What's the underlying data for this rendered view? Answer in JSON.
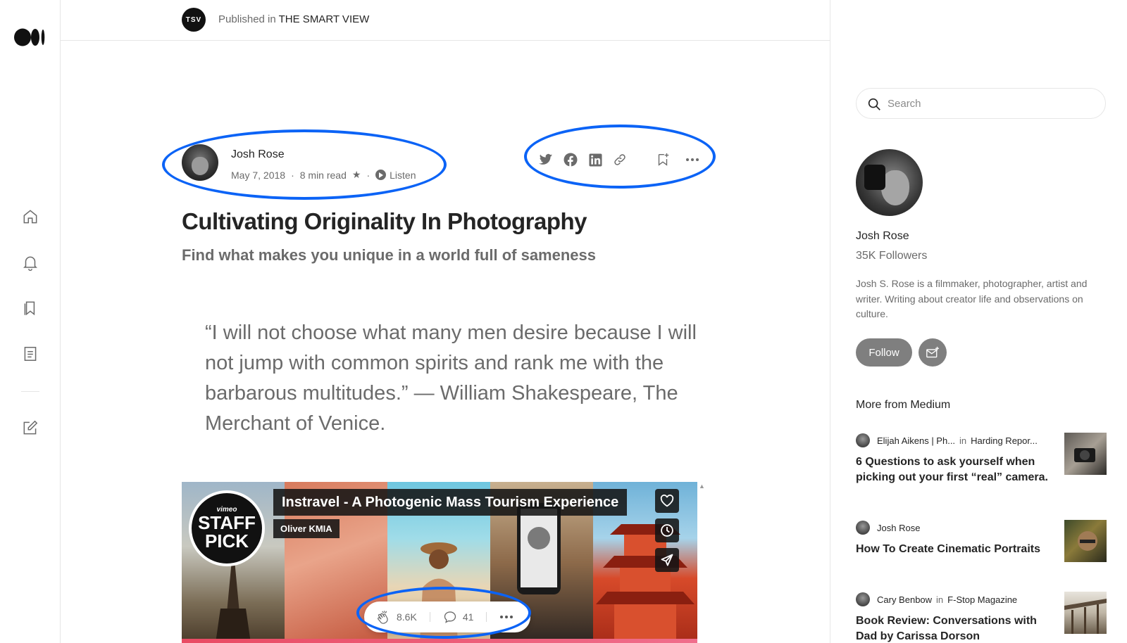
{
  "publication": {
    "logo_text": "TSV",
    "prefix": "Published in",
    "name": "THE SMART VIEW"
  },
  "article": {
    "author": "Josh Rose",
    "date": "May 7, 2018",
    "read_time": "8 min read",
    "listen_label": "Listen",
    "title": "Cultivating Originality In Photography",
    "subtitle": "Find what makes you unique in a world full of sameness",
    "quote": "“I will not choose what many men desire because I will not jump with common spirits and rank me with the barbarous multitudes.” — William Shakespeare, The Merchant of Venice."
  },
  "share_icons": [
    "twitter-icon",
    "facebook-icon",
    "linkedin-icon",
    "link-icon",
    "bookmark-add-icon",
    "more-icon"
  ],
  "embed": {
    "badge_top": "vimeo",
    "badge_line1": "STAFF",
    "badge_line2": "PICK",
    "video_title": "Instravel - A Photogenic Mass Tourism Experience",
    "video_author": "Oliver KMIA"
  },
  "reactions": {
    "claps": "8.6K",
    "comments": "41"
  },
  "sidebar": {
    "search_placeholder": "Search",
    "author_name": "Josh Rose",
    "followers": "35K Followers",
    "bio": "Josh S. Rose is a filmmaker, photographer, artist and writer. Writing about creator life and observations on culture.",
    "follow_label": "Follow",
    "more_title": "More from Medium",
    "stories": [
      {
        "author": "Elijah Aikens | Ph...",
        "in_label": "in",
        "publication": "Harding Repor...",
        "title": "6 Questions to ask yourself when picking out your first “real” camera."
      },
      {
        "author": "Josh Rose",
        "in_label": "",
        "publication": "",
        "title": "How To Create Cinematic Portraits"
      },
      {
        "author": "Cary Benbow",
        "in_label": "in",
        "publication": "F-Stop Magazine",
        "title": "Book Review: Conversations with Dad by Carissa Dorson"
      }
    ]
  },
  "colors": {
    "annotation": "#0b63f6",
    "muted_text": "#6b6b6b",
    "primary_text": "#242424"
  }
}
